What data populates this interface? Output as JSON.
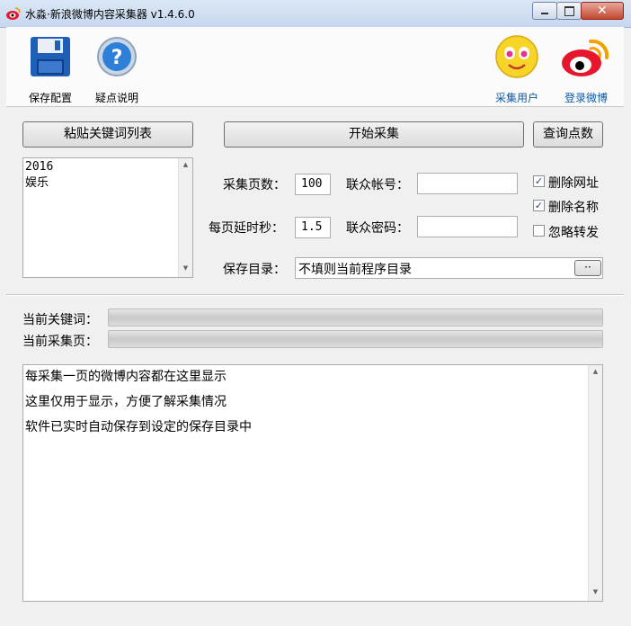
{
  "window": {
    "title": "水淼·新浪微博内容采集器 v1.4.6.0"
  },
  "toolbar": {
    "save_config": "保存配置",
    "help": "疑点说明",
    "collect_users": "采集用户",
    "login_weibo": "登录微博"
  },
  "buttons": {
    "paste_keywords": "粘贴关键词列表",
    "start_collect": "开始采集",
    "query_points": "查询点数",
    "browse": "··"
  },
  "keywords": {
    "lines": [
      "2016",
      "娱乐"
    ]
  },
  "form": {
    "pages_label": "采集页数：",
    "pages_value": "100",
    "delay_label": "每页延时秒：",
    "delay_value": "1.5",
    "account_label": "联众帐号：",
    "account_value": "",
    "password_label": "联众密码：",
    "password_value": "",
    "save_dir_label": "保存目录：",
    "save_dir_value": "不填则当前程序目录"
  },
  "options": {
    "delete_url": {
      "label": "删除网址",
      "checked": true
    },
    "delete_name": {
      "label": "删除名称",
      "checked": true
    },
    "ignore_repost": {
      "label": "忽略转发",
      "checked": false
    }
  },
  "status": {
    "current_keyword_label": "当前关键词：",
    "current_page_label": "当前采集页："
  },
  "log": {
    "lines": [
      "每采集一页的微博内容都在这里显示",
      "这里仅用于显示，方便了解采集情况",
      "软件已实时自动保存到设定的保存目录中"
    ]
  },
  "icons": {
    "app": "weibo-icon",
    "save": "floppy-disk-icon",
    "help": "question-icon",
    "users": "smiley-face-icon",
    "login": "weibo-logo-icon"
  }
}
